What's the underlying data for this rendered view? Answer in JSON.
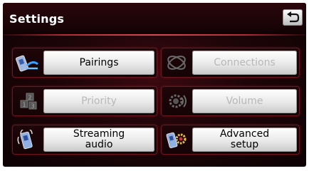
{
  "header": {
    "title": "Settings"
  },
  "back": {
    "icon": "back-arrow-icon"
  },
  "menu": [
    {
      "label": "Pairings",
      "icon": "phone-pairing-icon",
      "enabled": true
    },
    {
      "label": "Connections",
      "icon": "connection-rings-icon",
      "enabled": false
    },
    {
      "label": "Priority",
      "icon": "priority-numbers-icon",
      "enabled": false
    },
    {
      "label": "Volume",
      "icon": "volume-gear-icon",
      "enabled": false
    },
    {
      "label": "Streaming\naudio",
      "label_line1": "Streaming",
      "label_line2": "audio",
      "icon": "phone-audio-icon",
      "enabled": true
    },
    {
      "label": "Advanced\nsetup",
      "label_line1": "Advanced",
      "label_line2": "setup",
      "icon": "phone-gear-icon",
      "enabled": true
    }
  ],
  "colors": {
    "accent": "#b32a35",
    "background": "#1d0508",
    "button": "#e9e9e9",
    "disabled_text": "#b8b8b8"
  }
}
